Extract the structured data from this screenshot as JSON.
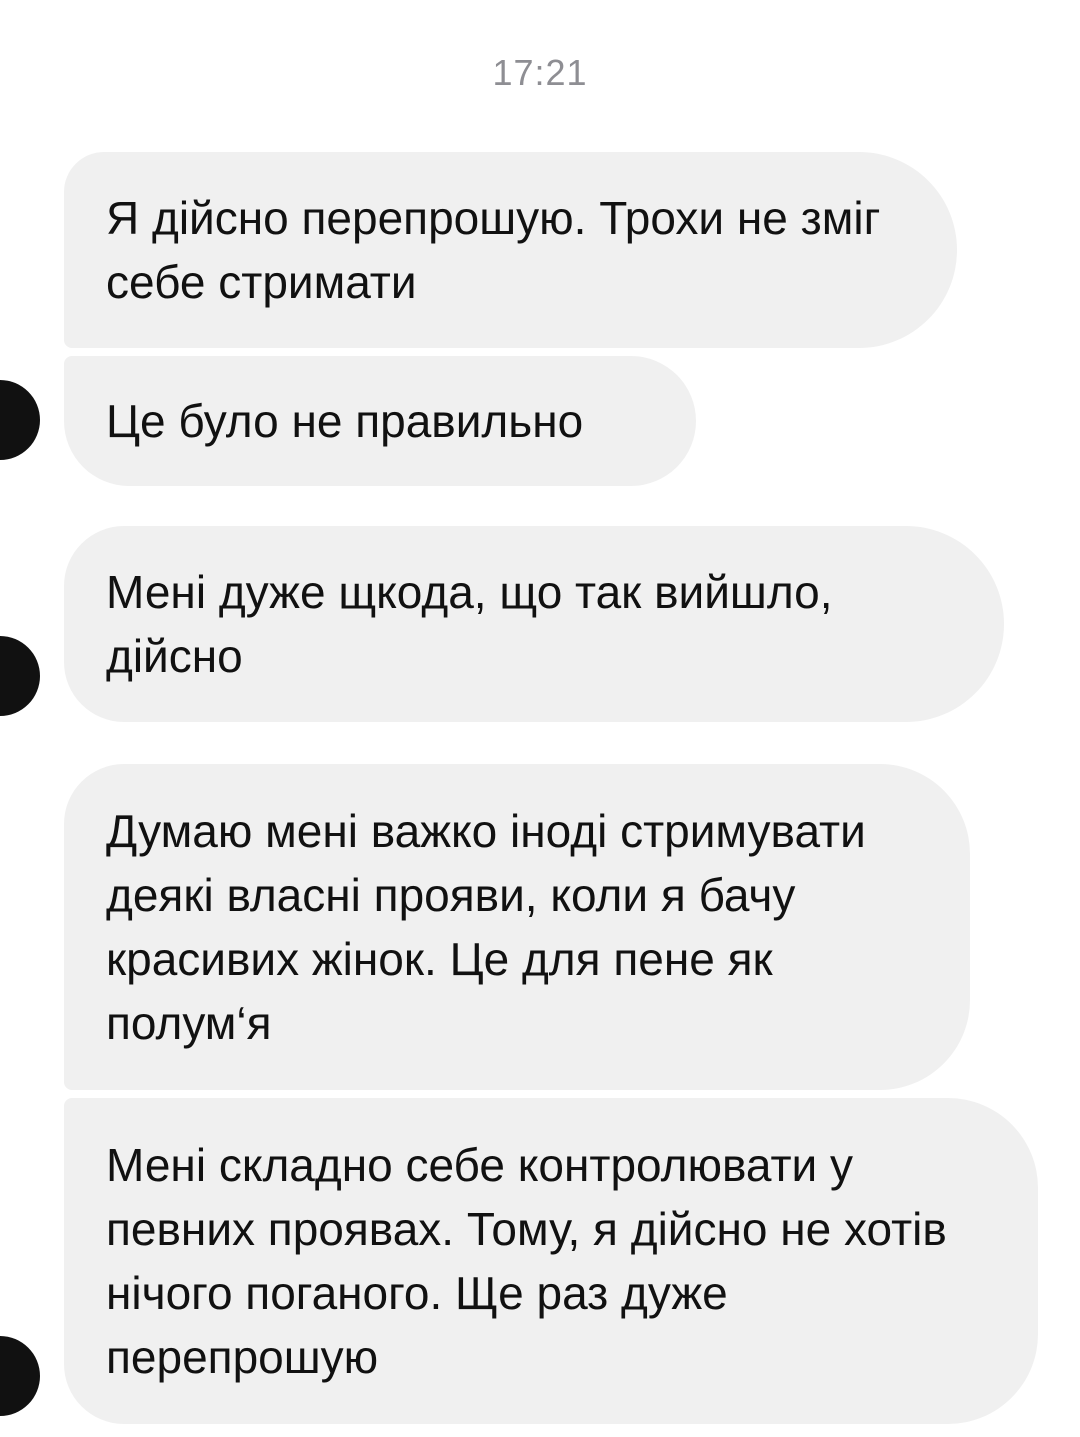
{
  "chat": {
    "timestamp": "17:21",
    "messages": [
      {
        "text": "Я дійсно перепрошую. Трохи не зміг себе стримати"
      },
      {
        "text": "Це було не правильно"
      },
      {
        "text": "Мені дуже щкода, що так вийшло, дійсно"
      },
      {
        "text": "Думаю мені важко іноді стримувати деякі власні прояви, коли я бачу красивих жінок. Це для пене як полум‘я"
      },
      {
        "text": "Мені складно себе контролювати у певних проявах. Тому, я дійсно не хотів нічого поганого. Ще раз дуже перепрошую"
      }
    ]
  },
  "colors": {
    "bubble_background": "#f0f0f0",
    "timestamp_text": "#8e8e93",
    "message_text": "#111111",
    "avatar": "#111111"
  },
  "icons": {
    "avatar": "avatar-icon"
  }
}
